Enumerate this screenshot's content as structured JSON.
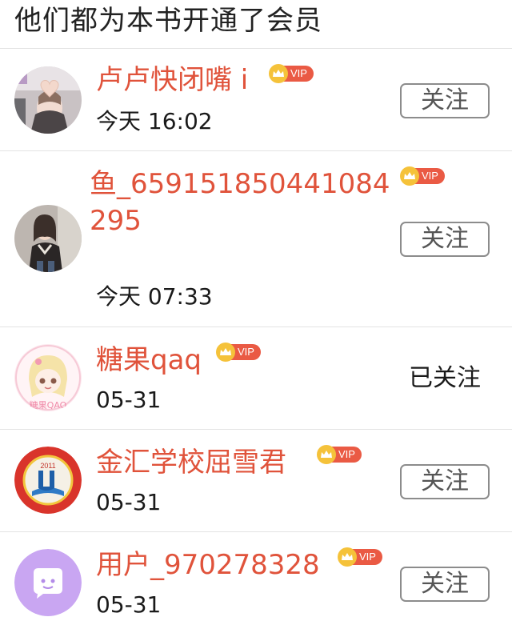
{
  "header": {
    "title": "他们都为本书开通了会员"
  },
  "vip_label": "VIP",
  "members": [
    {
      "name": "卢卢快闭嘴 i",
      "time": "今天 16:02",
      "follow_label": "关注",
      "followed": false
    },
    {
      "name": "鱼_659151850441084295",
      "time": "今天 07:33",
      "follow_label": "关注",
      "followed": false
    },
    {
      "name": "糖果qaq",
      "time": "05-31",
      "follow_label": "已关注",
      "followed": true
    },
    {
      "name": "金汇学校屈雪君",
      "time": "05-31",
      "follow_label": "关注",
      "followed": false
    },
    {
      "name": "用户_970278328",
      "time": "05-31",
      "follow_label": "关注",
      "followed": false
    }
  ],
  "avatar_labels": {
    "school_year": "2011",
    "candy_text": "糖果QAQ"
  },
  "colors": {
    "name": "#e0533b",
    "vip_tag": "#ea5a44",
    "vip_crown": "#f5c23a",
    "button_border": "#8c8c8c"
  },
  "icons": [
    "vip-crown-icon",
    "chat-bubble-icon"
  ]
}
